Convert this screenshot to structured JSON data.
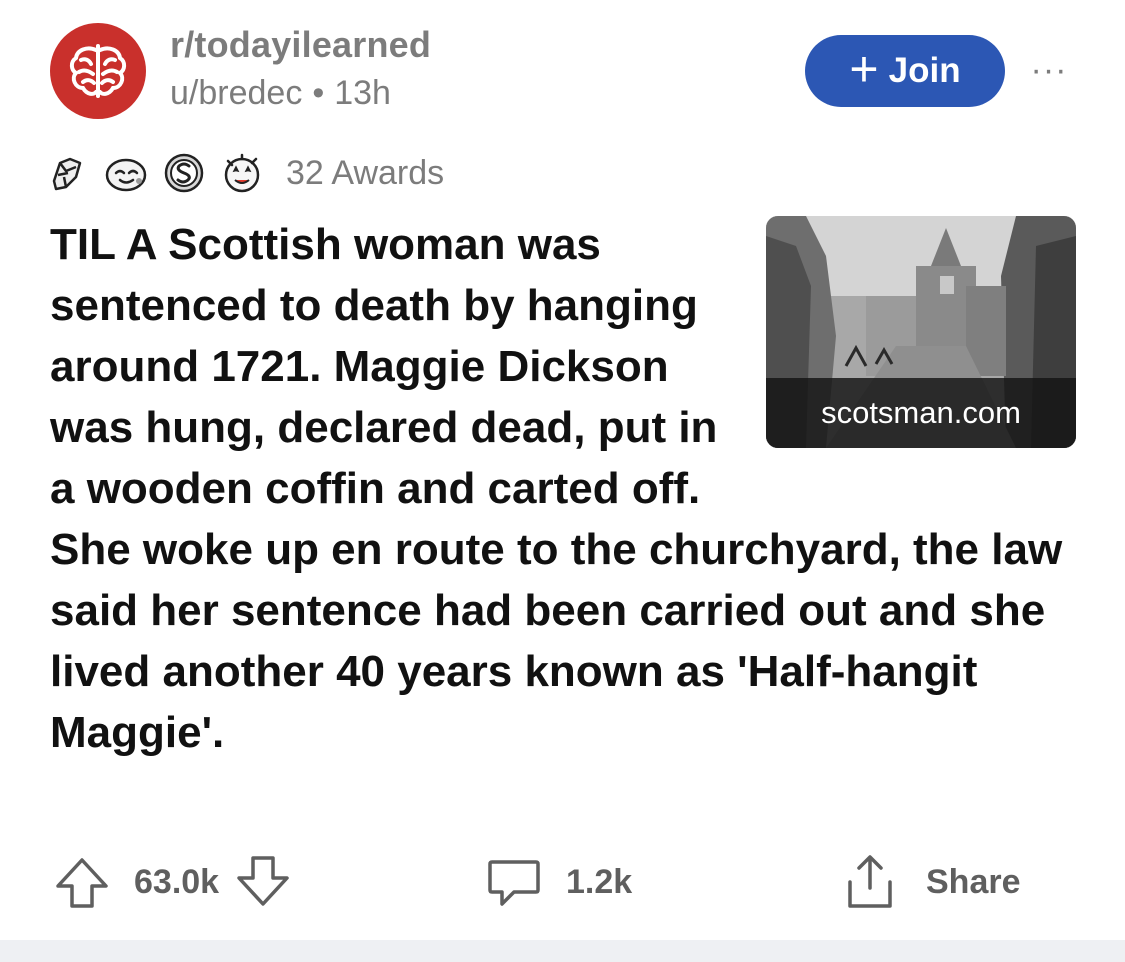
{
  "header": {
    "subreddit": "r/todayilearned",
    "author": "u/bredec",
    "separator": "•",
    "age": "13h",
    "join_label": "Join",
    "join_plus": "+",
    "more_label": "···"
  },
  "awards": {
    "icons": [
      "raised-fist-award-icon",
      "wholesome-award-icon",
      "silver-s-award-icon",
      "starstruck-award-icon"
    ],
    "count_label": "32 Awards"
  },
  "post": {
    "title": "TIL A Scottish woman was sentenced to death by hanging around 1721. Maggie Dickson was hung, declared dead, put in a wooden coffin and carted off. She woke up en route to the churchyard, the law said her sentence had been carried out and she lived another 40 years known as 'Half-hangit Maggie'.",
    "link_domain": "scotsman.com"
  },
  "actions": {
    "upvotes": "63.0k",
    "comments": "1.2k",
    "share_label": "Share"
  },
  "colors": {
    "join_button": "#2c57b4",
    "avatar": "#c9302c",
    "meta_text": "#7c7c7c"
  }
}
